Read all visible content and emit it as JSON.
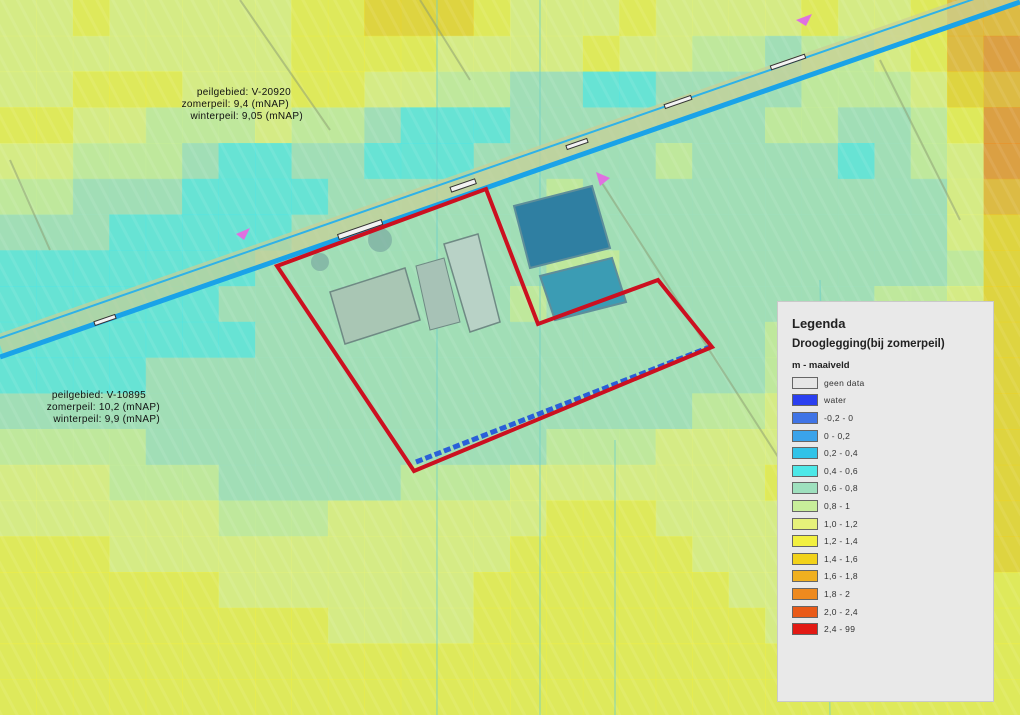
{
  "map": {
    "labels": [
      {
        "peilgebied": "peilgebied:  V-20920",
        "zomerpeil": "zomerpeil:  9,4  (mNAP)",
        "winterpeil": "winterpeil:  9,05  (mNAP)"
      },
      {
        "peilgebied": "peilgebied:  V-10895",
        "zomerpeil": "zomerpeil:  10,2  (mNAP)",
        "winterpeil": "winterpeil:  9,9  (mNAP)"
      }
    ],
    "colors": {
      "plot_outline": "#cc1020",
      "waterway": "#1aa3e8",
      "dashed_ditch": "#2a5fd8",
      "flow_arrow": "#e070e0"
    }
  },
  "legend": {
    "title": "Legenda",
    "subtitle": "Drooglegging(bij zomerpeil)",
    "unit": "m - maaiveld",
    "items": [
      {
        "label": "geen data",
        "color": "#e6e6e6"
      },
      {
        "label": "water",
        "color": "#2a3ff0"
      },
      {
        "label": "-0,2 - 0",
        "color": "#3f74e6"
      },
      {
        "label": "0 - 0,2",
        "color": "#3aa3ea"
      },
      {
        "label": "0,2 - 0,4",
        "color": "#30c3e8"
      },
      {
        "label": "0,4 - 0,6",
        "color": "#4de8e8"
      },
      {
        "label": "0,6 - 0,8",
        "color": "#9ee0be"
      },
      {
        "label": "0,8 - 1",
        "color": "#c8ee9a"
      },
      {
        "label": "1,0 - 1,2",
        "color": "#e6f27a"
      },
      {
        "label": "1,2 - 1,4",
        "color": "#f2f040"
      },
      {
        "label": "1,4 - 1,6",
        "color": "#f2d21a"
      },
      {
        "label": "1,6 - 1,8",
        "color": "#f0b020"
      },
      {
        "label": "1,8 - 2",
        "color": "#ee8a1e"
      },
      {
        "label": "2,0 - 2,4",
        "color": "#e95a18"
      },
      {
        "label": "2,4 - 99",
        "color": "#e21a14"
      }
    ]
  }
}
